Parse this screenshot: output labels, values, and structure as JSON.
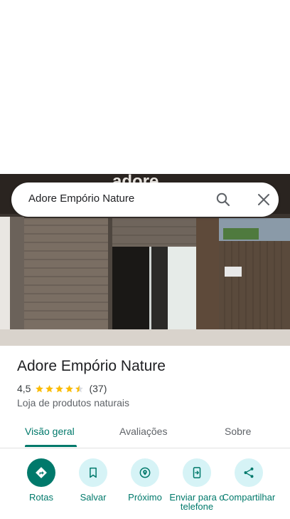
{
  "search": {
    "query": "Adore Empório Nature",
    "search_icon": "search-icon",
    "close_icon": "close-icon"
  },
  "photo": {
    "sign_text": "adore"
  },
  "place": {
    "name": "Adore Empório Nature",
    "rating": "4,5",
    "rating_value": 4.5,
    "reviews": "(37)",
    "category": "Loja de produtos naturais"
  },
  "tabs": [
    {
      "label": "Visão geral",
      "active": true
    },
    {
      "label": "Avaliações",
      "active": false
    },
    {
      "label": "Sobre",
      "active": false
    }
  ],
  "actions": [
    {
      "label": "Rotas",
      "icon": "directions-icon"
    },
    {
      "label": "Salvar",
      "icon": "bookmark-icon"
    },
    {
      "label": "Próximo",
      "icon": "nearby-icon"
    },
    {
      "label": "Enviar para o telefone",
      "icon": "send-to-phone-icon"
    },
    {
      "label": "Compartilhar",
      "icon": "share-icon"
    }
  ],
  "colors": {
    "accent": "#00796b",
    "action_bg": "#d6f3f6",
    "star": "#fbbc04"
  }
}
